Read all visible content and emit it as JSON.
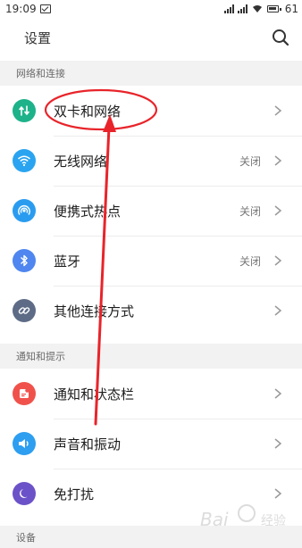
{
  "status_bar": {
    "time": "19:09",
    "battery": "61",
    "icons": [
      "message-icon",
      "signal-icon",
      "signal-icon",
      "wifi-icon",
      "battery-icon"
    ]
  },
  "header": {
    "title": "设置",
    "search_icon": "search-icon"
  },
  "sections": [
    {
      "title": "网络和连接",
      "items": [
        {
          "label": "双卡和网络",
          "status": "",
          "icon": "dual-sim-icon",
          "color": "#1db28a"
        },
        {
          "label": "无线网络",
          "status": "关闭",
          "icon": "wifi-icon",
          "color": "#2aa4f0"
        },
        {
          "label": "便携式热点",
          "status": "关闭",
          "icon": "hotspot-icon",
          "color": "#2a9cf0"
        },
        {
          "label": "蓝牙",
          "status": "关闭",
          "icon": "bluetooth-icon",
          "color": "#4f86f0"
        },
        {
          "label": "其他连接方式",
          "status": "",
          "icon": "link-icon",
          "color": "#5d6b86"
        }
      ]
    },
    {
      "title": "通知和提示",
      "items": [
        {
          "label": "通知和状态栏",
          "status": "",
          "icon": "notification-icon",
          "color": "#f0524b"
        },
        {
          "label": "声音和振动",
          "status": "",
          "icon": "sound-icon",
          "color": "#2d9ef0"
        },
        {
          "label": "免打扰",
          "status": "",
          "icon": "moon-icon",
          "color": "#6c52c8"
        }
      ]
    },
    {
      "title": "设备",
      "items": []
    }
  ],
  "annotation": {
    "color": "#e8242a"
  },
  "watermark": {
    "text": "Bai",
    "text2": "经验"
  }
}
